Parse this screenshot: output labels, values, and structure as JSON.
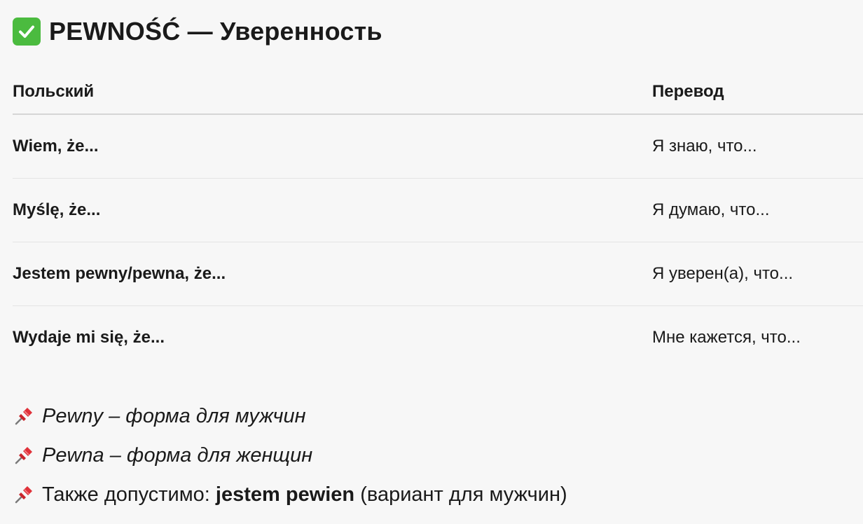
{
  "title": {
    "icon": "check-mark-icon",
    "text": "PEWNOŚĆ — Уверенность",
    "colors": {
      "check_bg": "#4bbb3f"
    }
  },
  "table": {
    "headers": {
      "polish": "Польский",
      "translation": "Перевод"
    },
    "rows": [
      {
        "polish": "Wiem, że...",
        "translation": "Я знаю, что..."
      },
      {
        "polish": "Myślę, że...",
        "translation": "Я думаю, что..."
      },
      {
        "polish": "Jestem pewny/pewna, że...",
        "translation": "Я уверен(а), что..."
      },
      {
        "polish": "Wydaje mi się, że...",
        "translation": "Мне кажется, что..."
      }
    ]
  },
  "notes": {
    "icon": "pushpin-icon",
    "items": [
      {
        "text": "Pewny – форма для мужчин"
      },
      {
        "text": "Pewna – форма для женщин"
      },
      {
        "prefix": "Также допустимо: ",
        "bold": "jestem pewien",
        "suffix": " (вариант для мужчин)"
      }
    ]
  }
}
